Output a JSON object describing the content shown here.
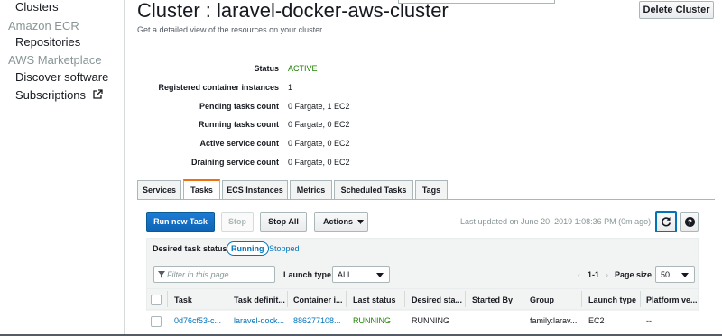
{
  "sidebar": {
    "clusters": "Clusters",
    "ecr_section": "Amazon ECR",
    "repositories": "Repositories",
    "marketplace_section": "AWS Marketplace",
    "discover": "Discover software",
    "subscriptions": "Subscriptions"
  },
  "header": {
    "title": "Cluster : laravel-docker-aws-cluster",
    "delete_button": "Delete Cluster",
    "subtitle": "Get a detailed view of the resources on your cluster."
  },
  "details": [
    {
      "label": "Status",
      "value": "ACTIVE"
    },
    {
      "label": "Registered container instances",
      "value": "1"
    },
    {
      "label": "Pending tasks count",
      "value": "0 Fargate, 1 EC2"
    },
    {
      "label": "Running tasks count",
      "value": "0 Fargate, 0 EC2"
    },
    {
      "label": "Active service count",
      "value": "0 Fargate, 0 EC2"
    },
    {
      "label": "Draining service count",
      "value": "0 Fargate, 0 EC2"
    }
  ],
  "tabs": [
    {
      "label": "Services"
    },
    {
      "label": "Tasks"
    },
    {
      "label": "ECS Instances"
    },
    {
      "label": "Metrics"
    },
    {
      "label": "Scheduled Tasks"
    },
    {
      "label": "Tags"
    }
  ],
  "toolbar": {
    "run_new_task": "Run new Task",
    "stop": "Stop",
    "stop_all": "Stop All",
    "actions": "Actions",
    "last_updated": "Last updated on June 20, 2019 1:08:36 PM (0m ago)"
  },
  "filters": {
    "desired_status_label": "Desired task status:",
    "running": "Running",
    "stopped": "Stopped",
    "filter_placeholder": "Filter in this page",
    "launch_type_label": "Launch type",
    "launch_type_value": "ALL",
    "page_range": "1-1",
    "page_size_label": "Page size",
    "page_size_value": "50"
  },
  "table": {
    "headers": [
      "Task",
      "Task definit...",
      "Container i...",
      "Last status",
      "Desired sta...",
      "Started By",
      "Group",
      "Launch type",
      "Platform ve..."
    ],
    "rows": [
      [
        "0d76cf53-c...",
        "laravel-dock...",
        "886277108...",
        "RUNNING",
        "RUNNING",
        "",
        "family:larav...",
        "EC2",
        "--"
      ]
    ]
  },
  "colors": {
    "accent_orange": "#ec7211",
    "link_blue": "#0073bb",
    "status_green": "#1d8102",
    "primary_button": "#0f65b6"
  }
}
